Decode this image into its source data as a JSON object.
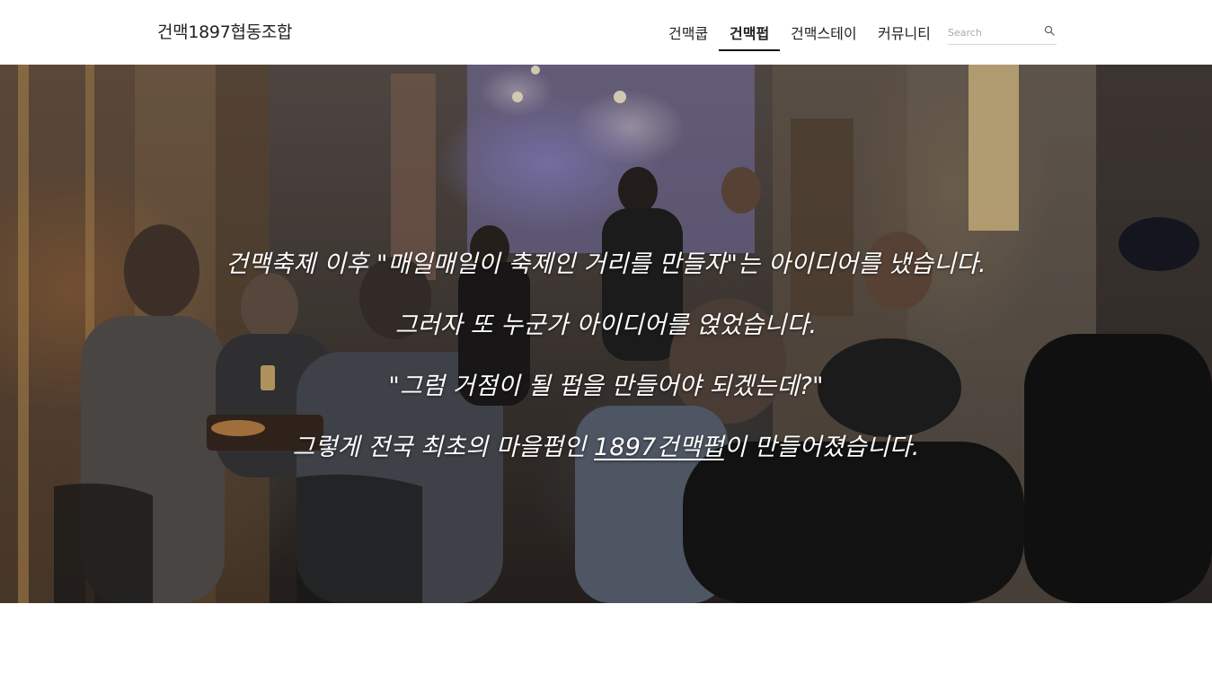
{
  "site": {
    "title": "건맥1897협동조합"
  },
  "nav": {
    "items": [
      {
        "label": "건맥쿱",
        "active": false
      },
      {
        "label": "건맥펍",
        "active": true
      },
      {
        "label": "건맥스테이",
        "active": false
      },
      {
        "label": "커뮤니티",
        "active": false
      }
    ]
  },
  "search": {
    "placeholder": "Search",
    "value": "",
    "icon": "search-icon"
  },
  "hero": {
    "line1": "건맥축제 이후 \"매일매일이 축제인 거리를 만들자\"는 아이디어를 냈습니다.",
    "line2": "그러자 또 누군가 아이디어를 얹었습니다.",
    "line3": "\"그럼 거점이 될 펍을 만들어야 되겠는데?\"",
    "line4_prefix": "그렇게 전국 최초의 마을펍인 ",
    "line4_link": "1897건맥펍",
    "line4_suffix": "이 만들어졌습니다."
  },
  "colors": {
    "text": "#222222",
    "active_underline": "#111111",
    "hero_text": "#ffffff"
  }
}
